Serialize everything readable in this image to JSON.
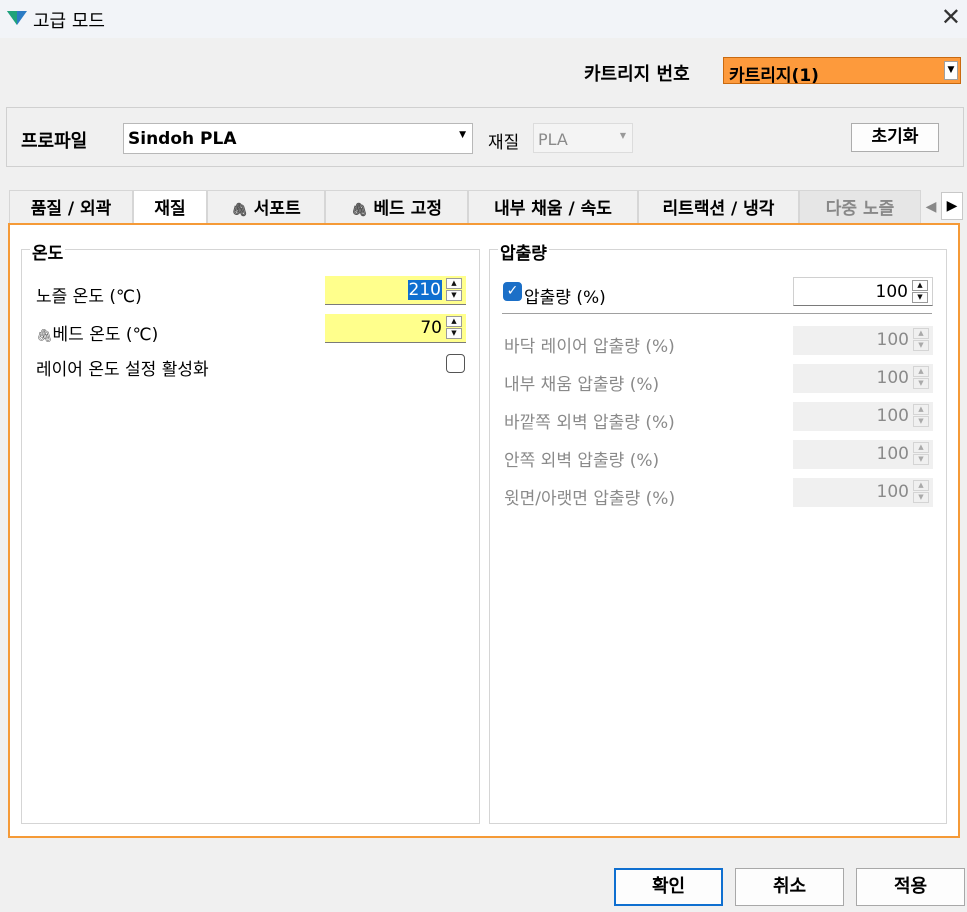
{
  "window": {
    "title": "고급 모드",
    "close_icon": "close-icon",
    "app_icon": "app-logo-icon"
  },
  "cartridge": {
    "label": "카트리지 번호",
    "value": "카트리지(1)",
    "color": "#fd9a3c"
  },
  "profile": {
    "label": "프로파일",
    "value": "Sindoh PLA",
    "material_label": "재질",
    "material_value": "PLA",
    "reset_label": "초기화"
  },
  "tabs": [
    {
      "label": "품질 / 외곽",
      "active": false,
      "icon": ""
    },
    {
      "label": "재질",
      "active": true,
      "icon": ""
    },
    {
      "label": "서포트",
      "active": false,
      "icon": "paperclip-icon"
    },
    {
      "label": "베드 고정",
      "active": false,
      "icon": "paperclip-icon"
    },
    {
      "label": "내부 채움 / 속도",
      "active": false,
      "icon": ""
    },
    {
      "label": "리트랙션 / 냉각",
      "active": false,
      "icon": ""
    },
    {
      "label": "다중 노즐",
      "active": false,
      "icon": ""
    }
  ],
  "temperature": {
    "title": "온도",
    "nozzle_label": "노즐 온도 (℃)",
    "nozzle_value": "210",
    "bed_label": "베드 온도 (℃)",
    "bed_value": "70",
    "layer_temp_label": "레이어 온도 설정 활성화",
    "layer_temp_checked": false
  },
  "extrusion": {
    "title": "압출량",
    "main_label": "압출량 (%)",
    "main_value": "100",
    "main_checked": true,
    "rows": [
      {
        "label": "바닥 레이어 압출량 (%)",
        "value": "100"
      },
      {
        "label": "내부 채움 압출량 (%)",
        "value": "100"
      },
      {
        "label": "바깥쪽 외벽 압출량 (%)",
        "value": "100"
      },
      {
        "label": "안쪽 외벽 압출량 (%)",
        "value": "100"
      },
      {
        "label": "윗면/아랫면 압출량 (%)",
        "value": "100"
      }
    ]
  },
  "buttons": {
    "ok": "확인",
    "cancel": "취소",
    "apply": "적용"
  }
}
